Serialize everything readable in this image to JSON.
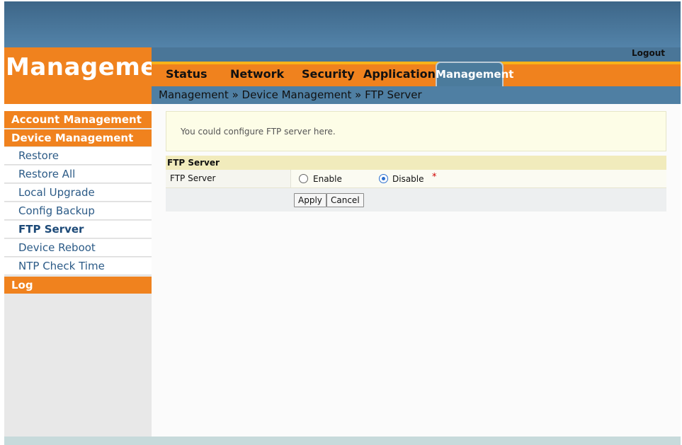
{
  "header": {
    "brand_title": "Management",
    "logout": "Logout"
  },
  "nav": {
    "items": [
      "Status",
      "Network",
      "Security",
      "Application"
    ],
    "active": "Management"
  },
  "breadcrumb": "Management » Device Management » FTP Server",
  "sidebar": {
    "categories": [
      "Account Management",
      "Device Management",
      "Log"
    ],
    "device_items": [
      "Restore",
      "Restore All",
      "Local Upgrade",
      "Config Backup",
      "FTP Server",
      "Device Reboot",
      "NTP Check Time"
    ],
    "selected_item": "FTP Server"
  },
  "main": {
    "info_text": "You could configure FTP server here.",
    "section_title": "FTP Server",
    "field_label": "FTP Server",
    "option_enable": "Enable",
    "option_disable": "Disable",
    "selected_option": "Disable",
    "required_mark": "*",
    "apply_label": "Apply",
    "cancel_label": "Cancel"
  },
  "colors": {
    "accent_orange": "#f0821e",
    "header_blue": "#4a7698",
    "active_tab": "#4b7b9c"
  }
}
